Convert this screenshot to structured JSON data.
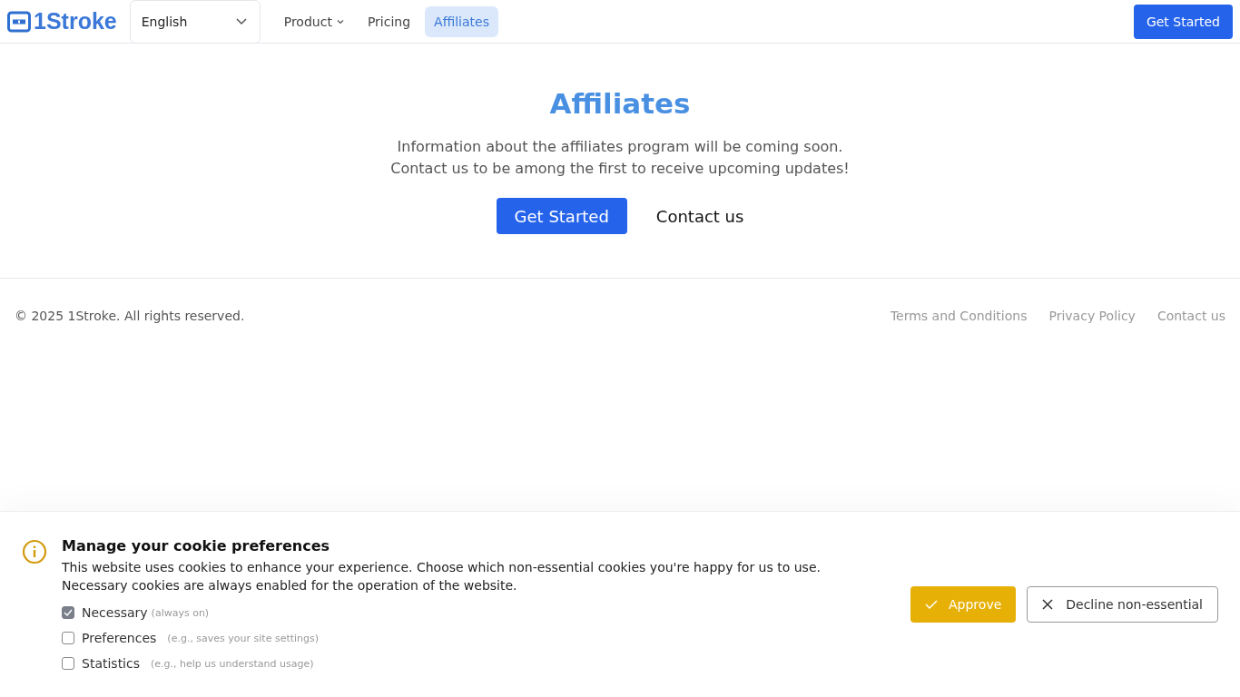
{
  "header": {
    "logo": "1Stroke",
    "language": {
      "value": "English"
    },
    "nav": [
      {
        "label": "Product",
        "kind": "menu",
        "selected": false
      },
      {
        "label": "Pricing",
        "kind": "link",
        "selected": false
      },
      {
        "label": "Affiliates",
        "kind": "link",
        "selected": true
      }
    ],
    "cta": "Get Started"
  },
  "hero": {
    "title": "Affiliates",
    "lines": [
      "Information about the affiliates program will be coming soon.",
      "Contact us to be among the first to receive upcoming updates!"
    ],
    "primary": "Get Started",
    "secondary": "Contact us"
  },
  "footer": {
    "copyright": "© 2025 1Stroke. All rights reserved.",
    "links": [
      "Terms and Conditions",
      "Privacy Policy",
      "Contact us"
    ]
  },
  "cookie": {
    "title": "Manage your cookie preferences",
    "text": "This website uses cookies to enhance your experience. Choose which non-essential cookies you're happy for us to use. Necessary cookies are always enabled for the operation of the website.",
    "options": [
      {
        "label": "Necessary",
        "hint": "(always on)",
        "checked": true,
        "disabled": true
      },
      {
        "label": "Preferences",
        "hint": "(e.g., saves your site settings)",
        "checked": false,
        "disabled": false
      },
      {
        "label": "Statistics",
        "hint": "(e.g., help us understand usage)",
        "checked": false,
        "disabled": false
      }
    ],
    "approve": "Approve",
    "decline": "Decline non-essential"
  }
}
